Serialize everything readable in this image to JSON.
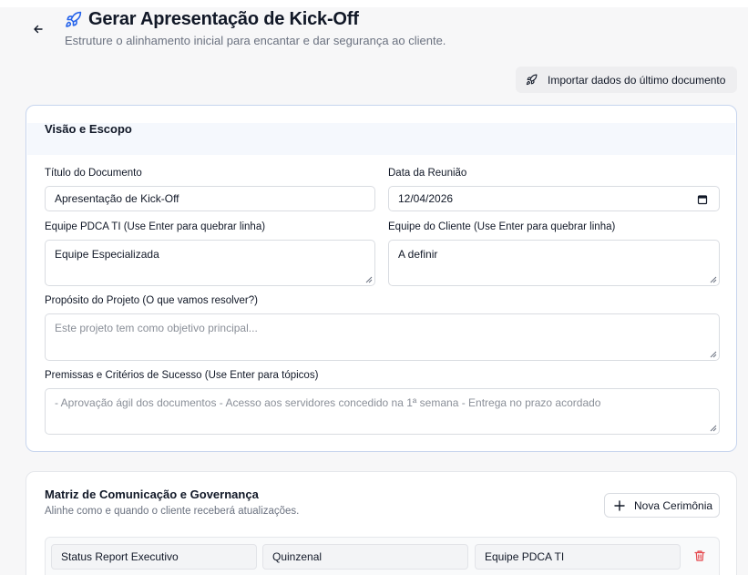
{
  "header": {
    "title": "Gerar Apresentação de Kick-Off",
    "subtitle": "Estruture o alinhamento inicial para encantar e dar segurança ao cliente.",
    "import_label": "Importar dados do último documento"
  },
  "vision": {
    "section_title": "Visão e Escopo",
    "doc_title_label": "Título do Documento",
    "doc_title_value": "Apresentação de Kick-Off",
    "meeting_date_label": "Data da Reunião",
    "meeting_date_value": "12/04/2026",
    "team_label": "Equipe PDCA TI (Use Enter para quebrar linha)",
    "team_value": "Equipe Especializada",
    "client_team_label": "Equipe do Cliente (Use Enter para quebrar linha)",
    "client_team_value": "A definir",
    "purpose_label": "Propósito do Projeto (O que vamos resolver?)",
    "purpose_placeholder": "Este projeto tem como objetivo principal...",
    "premises_label": "Premissas e Critérios de Sucesso (Use Enter para tópicos)",
    "premises_placeholder": "- Aprovação ágil dos documentos - Acesso aos servidores concedido na 1ª semana - Entrega no prazo acordado"
  },
  "matrix": {
    "section_title": "Matriz de Comunicação e Governança",
    "section_subtitle": "Alinhe como e quando o cliente receberá atualizações.",
    "new_button_label": "Nova Cerimônia",
    "rows": [
      {
        "ceremony": "Status Report Executivo",
        "frequency": "Quinzenal",
        "owner": "Equipe PDCA TI"
      }
    ]
  },
  "colors": {
    "accent": "#2563eb",
    "danger": "#e5484d",
    "card_border_active": "#c7d5ee"
  },
  "icons": {
    "back": "arrow-left-icon",
    "title": "rocket-icon",
    "import": "rocket-icon",
    "add": "plus-icon",
    "delete": "trash-icon",
    "date": "calendar-icon"
  }
}
